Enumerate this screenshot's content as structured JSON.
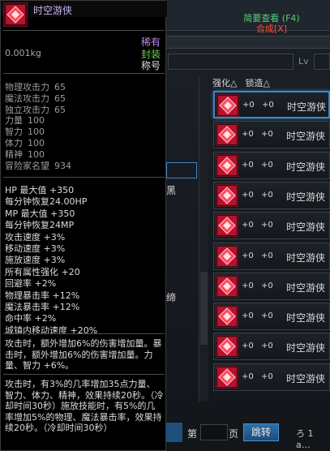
{
  "item": {
    "name": "时空游侠",
    "rarity": "稀有",
    "seal": "封装",
    "type": "称号",
    "weight": "0.001kg"
  },
  "base_stats": [
    {
      "label": "物理攻击力",
      "value": "65"
    },
    {
      "label": "魔法攻击力",
      "value": "65"
    },
    {
      "label": "独立攻击力",
      "value": "65"
    },
    {
      "label": "力量",
      "value": "100"
    },
    {
      "label": "智力",
      "value": "100"
    },
    {
      "label": "体力",
      "value": "100"
    },
    {
      "label": "精神",
      "value": "100"
    },
    {
      "label": "冒险家名望",
      "value": "934"
    }
  ],
  "bonus_stats": [
    "HP 最大值 +350",
    "每分钟恢复24.00HP",
    "MP 最大值 +350",
    "每分钟恢复24MP",
    "攻击速度 +3%",
    "移动速度 +3%",
    "施放速度 +3%",
    "所有属性强化 +20",
    "回避率 +2%",
    "物理暴击率 +12%",
    "魔法暴击率 +12%",
    "命中率 +2%",
    "城镇内移动速度 +20%"
  ],
  "desc1": "攻击时，额外增加6%的伤害增加量。暴击时，额外增加6%的伤害增加量。力量、智力 +6%。",
  "desc2": "攻击时，有3%的几率增加35点力量、智力、体力、精神，效果持续20秒。（冷却时间30秒）施放技能时，有5%的几率增加5%的物理、魔法暴击率，效果持续20秒。（冷却时间30秒）",
  "right_panel": {
    "brief_view": "简要查看 (F4)",
    "combine": "合成[X]",
    "lv_label": "Lv",
    "col_enhance": "强化△",
    "col_lock": "锁造△",
    "partial_text_1": "黑",
    "partial_text_2": "缔",
    "results": [
      {
        "enhance": "+0",
        "lock": "+0",
        "name": "时空游侠"
      },
      {
        "enhance": "+0",
        "lock": "+0",
        "name": "时空游侠"
      },
      {
        "enhance": "+0",
        "lock": "+0",
        "name": "时空游侠"
      },
      {
        "enhance": "+0",
        "lock": "+0",
        "name": "时空游侠"
      },
      {
        "enhance": "+0",
        "lock": "+0",
        "name": "时空游侠"
      },
      {
        "enhance": "+0",
        "lock": "+0",
        "name": "时空游侠"
      },
      {
        "enhance": "+0",
        "lock": "+0",
        "name": "时空游侠"
      },
      {
        "enhance": "+0",
        "lock": "+0",
        "name": "时空游侠"
      },
      {
        "enhance": "+0",
        "lock": "+0",
        "name": "时空游侠"
      },
      {
        "enhance": "+0",
        "lock": "+0",
        "name": "时空游侠"
      }
    ],
    "page_prefix": "第",
    "page_suffix": "页",
    "jump_label": "跳转",
    "tail_text": "ろ 1 a…"
  },
  "colors": {
    "item_name": "#c8b4f0",
    "rarity": "#b98ae8",
    "seal": "#6fd14a",
    "brief_view": "#4fd17a",
    "combine": "#ff4a3a",
    "selected_border": "#3d86c6"
  },
  "icons": [
    "title-gem-icon",
    "scroll-down-icon"
  ]
}
